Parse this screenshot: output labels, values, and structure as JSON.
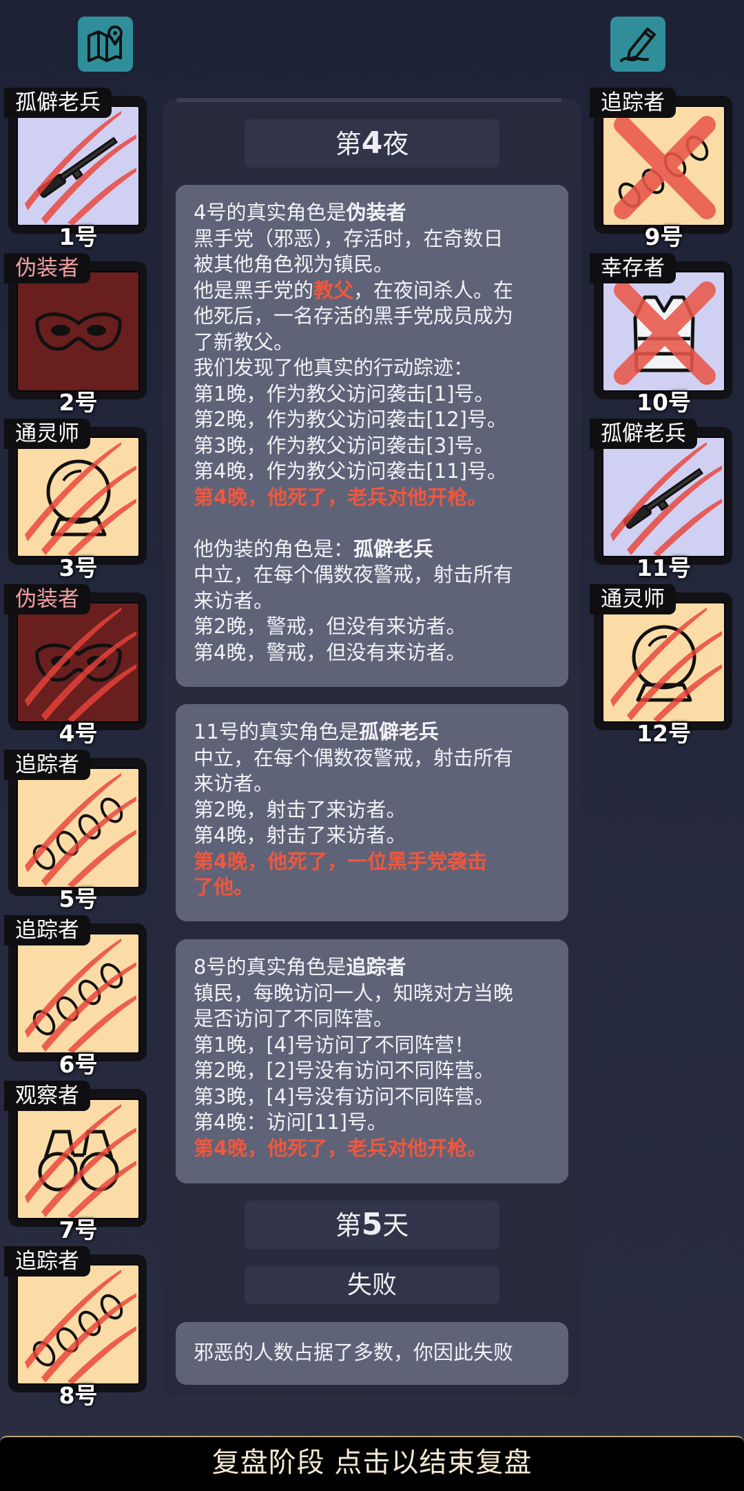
{
  "left_cards": [
    {
      "role": "孤僻老兵",
      "num": "1号",
      "icon": "rifle-icon",
      "bg": "lav",
      "tag_color": "white",
      "marked": "claw"
    },
    {
      "role": "伪装者",
      "num": "2号",
      "icon": "mask-icon",
      "bg": "maroon",
      "tag_color": "pink",
      "marked": "none"
    },
    {
      "role": "通灵师",
      "num": "3号",
      "icon": "crystal-ball-icon",
      "bg": "beige",
      "tag_color": "white",
      "marked": "claw"
    },
    {
      "role": "伪装者",
      "num": "4号",
      "icon": "mask-icon",
      "bg": "maroon",
      "tag_color": "pink",
      "marked": "claw"
    },
    {
      "role": "追踪者",
      "num": "5号",
      "icon": "footprints-icon",
      "bg": "beige",
      "tag_color": "white",
      "marked": "claw"
    },
    {
      "role": "追踪者",
      "num": "6号",
      "icon": "footprints-icon",
      "bg": "beige",
      "tag_color": "white",
      "marked": "claw"
    },
    {
      "role": "观察者",
      "num": "7号",
      "icon": "binoculars-icon",
      "bg": "beige",
      "tag_color": "white",
      "marked": "claw"
    },
    {
      "role": "追踪者",
      "num": "8号",
      "icon": "footprints-icon",
      "bg": "beige",
      "tag_color": "white",
      "marked": "claw"
    }
  ],
  "right_cards": [
    {
      "role": "追踪者",
      "num": "9号",
      "icon": "footprints-icon",
      "bg": "beige",
      "tag_color": "white",
      "marked": "cross"
    },
    {
      "role": "幸存者",
      "num": "10号",
      "icon": "vest-icon",
      "bg": "lav",
      "tag_color": "white",
      "marked": "cross"
    },
    {
      "role": "孤僻老兵",
      "num": "11号",
      "icon": "rifle-icon",
      "bg": "lav",
      "tag_color": "white",
      "marked": "claw"
    },
    {
      "role": "通灵师",
      "num": "12号",
      "icon": "crystal-ball-icon",
      "bg": "beige",
      "tag_color": "white",
      "marked": "claw"
    }
  ],
  "night_header": {
    "pre": "第",
    "num": "4",
    "post": "夜"
  },
  "reveal1": {
    "l1a": "4号的真实角色是",
    "l1b": "伪装者",
    "l2": "黑手党（邪恶），存活时，在奇数日",
    "l3": "被其他角色视为镇民。",
    "l4a": "他是黑手党的",
    "l4b": "教父",
    "l4c": "，在夜间杀人。在",
    "l5": "他死后，一名存活的黑手党成员成为",
    "l6": "了新教父。",
    "l7": "我们发现了他真实的行动踪迹：",
    "l8": "第1晚，作为教父访问袭击[1]号。",
    "l9": "第2晚，作为教父访问袭击[12]号。",
    "l10": "第3晚，作为教父访问袭击[3]号。",
    "l11": "第4晚，作为教父访问袭击[11]号。",
    "l12": "第4晚，他死了，老兵对他开枪。",
    "l13a": "他伪装的角色是：",
    "l13b": "孤僻老兵",
    "l14": "中立，在每个偶数夜警戒，射击所有",
    "l15": "来访者。",
    "l16": "第2晚，警戒，但没有来访者。",
    "l17": "第4晚，警戒，但没有来访者。"
  },
  "reveal2": {
    "l1a": "11号的真实角色是",
    "l1b": "孤僻老兵",
    "l2": "中立，在每个偶数夜警戒，射击所有",
    "l3": "来访者。",
    "l4": "第2晚，射击了来访者。",
    "l5": "第4晚，射击了来访者。",
    "l6": "第4晚，他死了，一位黑手党袭击",
    "l7": "了他。"
  },
  "reveal3": {
    "l1a": "8号的真实角色是",
    "l1b": "追踪者",
    "l2": "镇民，每晚访问一人，知晓对方当晚",
    "l3": "是否访问了不同阵营。",
    "l4": "第1晚，[4]号访问了不同阵营！",
    "l5": "第2晚，[2]号没有访问不同阵营。",
    "l6": "第3晚，[4]号没有访问不同阵营。",
    "l7": "第4晚：访问[11]号。",
    "l8": "第4晚，他死了，老兵对他开枪。"
  },
  "day_header": {
    "pre": "第",
    "num": "5",
    "post": "天"
  },
  "result_header": "失败",
  "result_text": "邪恶的人数占据了多数，你因此失败",
  "bottom_bar": "复盘阶段 点击以结束复盘",
  "colors": {
    "accent_red": "#f0573d",
    "teal_button": "#2f8e9a",
    "bubble": "#5f6378",
    "panel": "#262a3c"
  }
}
